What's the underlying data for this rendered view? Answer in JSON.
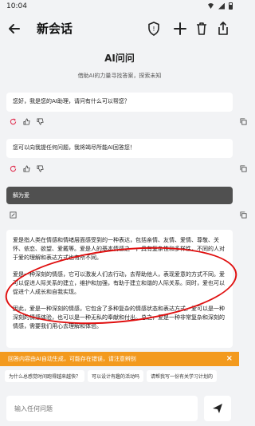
{
  "status": {
    "time": "10:04"
  },
  "appbar": {
    "title": "新会话"
  },
  "welcome": {
    "title": "AI问问",
    "subtitle": "借助AI的力量寻找答案，探索未知"
  },
  "messages": [
    {
      "role": "ai",
      "text": "您好，我是您的AI助理，请问有什么可以帮您？"
    },
    {
      "role": "ai",
      "text": "您可以向我提任何问题，我将竭尽所能AI回答您！"
    },
    {
      "role": "user",
      "text": "解为爱"
    }
  ],
  "answer": {
    "paragraphs": [
      "爱是指人类在情感和情绪层面感受到的一种表达，包括亲情、友情、爱情、尊敬、关怀、依恋、欲望、爱戴等。爱是人的基本情感之一，具有复杂性和多样性，不同的人对于爱的理解和表达方式也有所不同。",
      "爱是一种深刻的情感，它可以激发人们去行动，去帮助他人，表现爱意的方式不同。爱可以促进人际关系的建立，维护和加强，有助于建立和谐的人际关系。同时，爱也可以促进个人成长和自我实现。",
      "因此，爱是一种深刻的情感，它包含了多种复杂的情感状态和表达方式。爱可以是一种深刻的情感体验，也可以是一种无私的奉献和付出。总之，爱是一种非常复杂和深刻的情感，需要我们用心去理解和体验。"
    ]
  },
  "banner": {
    "text": "回答内容由AI自动生成，可能存在错误，请注意辨别",
    "close": "×"
  },
  "suggestions": [
    "为什么总感觉时间跑得越来越快？",
    "可以设计有趣的活动吗",
    "请帮我写一份有关学习计划的"
  ],
  "input": {
    "placeholder": "输入任何问题"
  }
}
